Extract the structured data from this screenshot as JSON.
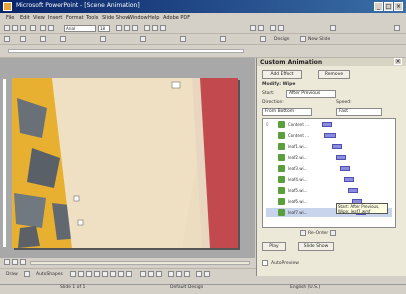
{
  "window": {
    "title": "Microsoft PowerPoint - [Scene Animation]"
  },
  "menu": [
    "File",
    "Edit",
    "View",
    "Insert",
    "Format",
    "Tools",
    "Slide Show",
    "Window",
    "Help",
    "Adobe PDF"
  ],
  "toolbar": {
    "font": "Arial",
    "size": "18",
    "design_label": "Design",
    "new_slide_label": "New Slide"
  },
  "taskpane": {
    "title": "Custom Animation",
    "add_effect_label": "Add Effect",
    "remove_label": "Remove",
    "modify_heading": "Modify: Wipe",
    "start_label": "Start:",
    "start_value": "After Previous",
    "direction_label": "Direction:",
    "direction_value": "From Bottom",
    "speed_label": "Speed:",
    "speed_value": "Fast",
    "items": [
      {
        "num": "0",
        "name": "Content ..."
      },
      {
        "num": "",
        "name": "Content ..."
      },
      {
        "num": "",
        "name": "leaf1.wi..."
      },
      {
        "num": "",
        "name": "leaf2.wi..."
      },
      {
        "num": "",
        "name": "leaf3.wi..."
      },
      {
        "num": "",
        "name": "leaf4.wi..."
      },
      {
        "num": "",
        "name": "leaf5.wi..."
      },
      {
        "num": "",
        "name": "leaf6.wi..."
      },
      {
        "num": "",
        "name": "leaf7.wi..."
      }
    ],
    "reorder_label": "Re-Order",
    "play_label": "Play",
    "slideshow_label": "Slide Show",
    "autopreview_label": "AutoPreview",
    "tooltip": "Start: After Previous, Wipe: leaf7.wmf"
  },
  "drawbar": {
    "draw_label": "Draw",
    "autoshapes_label": "AutoShapes"
  },
  "status": {
    "slide": "Slide 1 of 1",
    "design": "Default Design",
    "language": "English (U.S.)"
  }
}
